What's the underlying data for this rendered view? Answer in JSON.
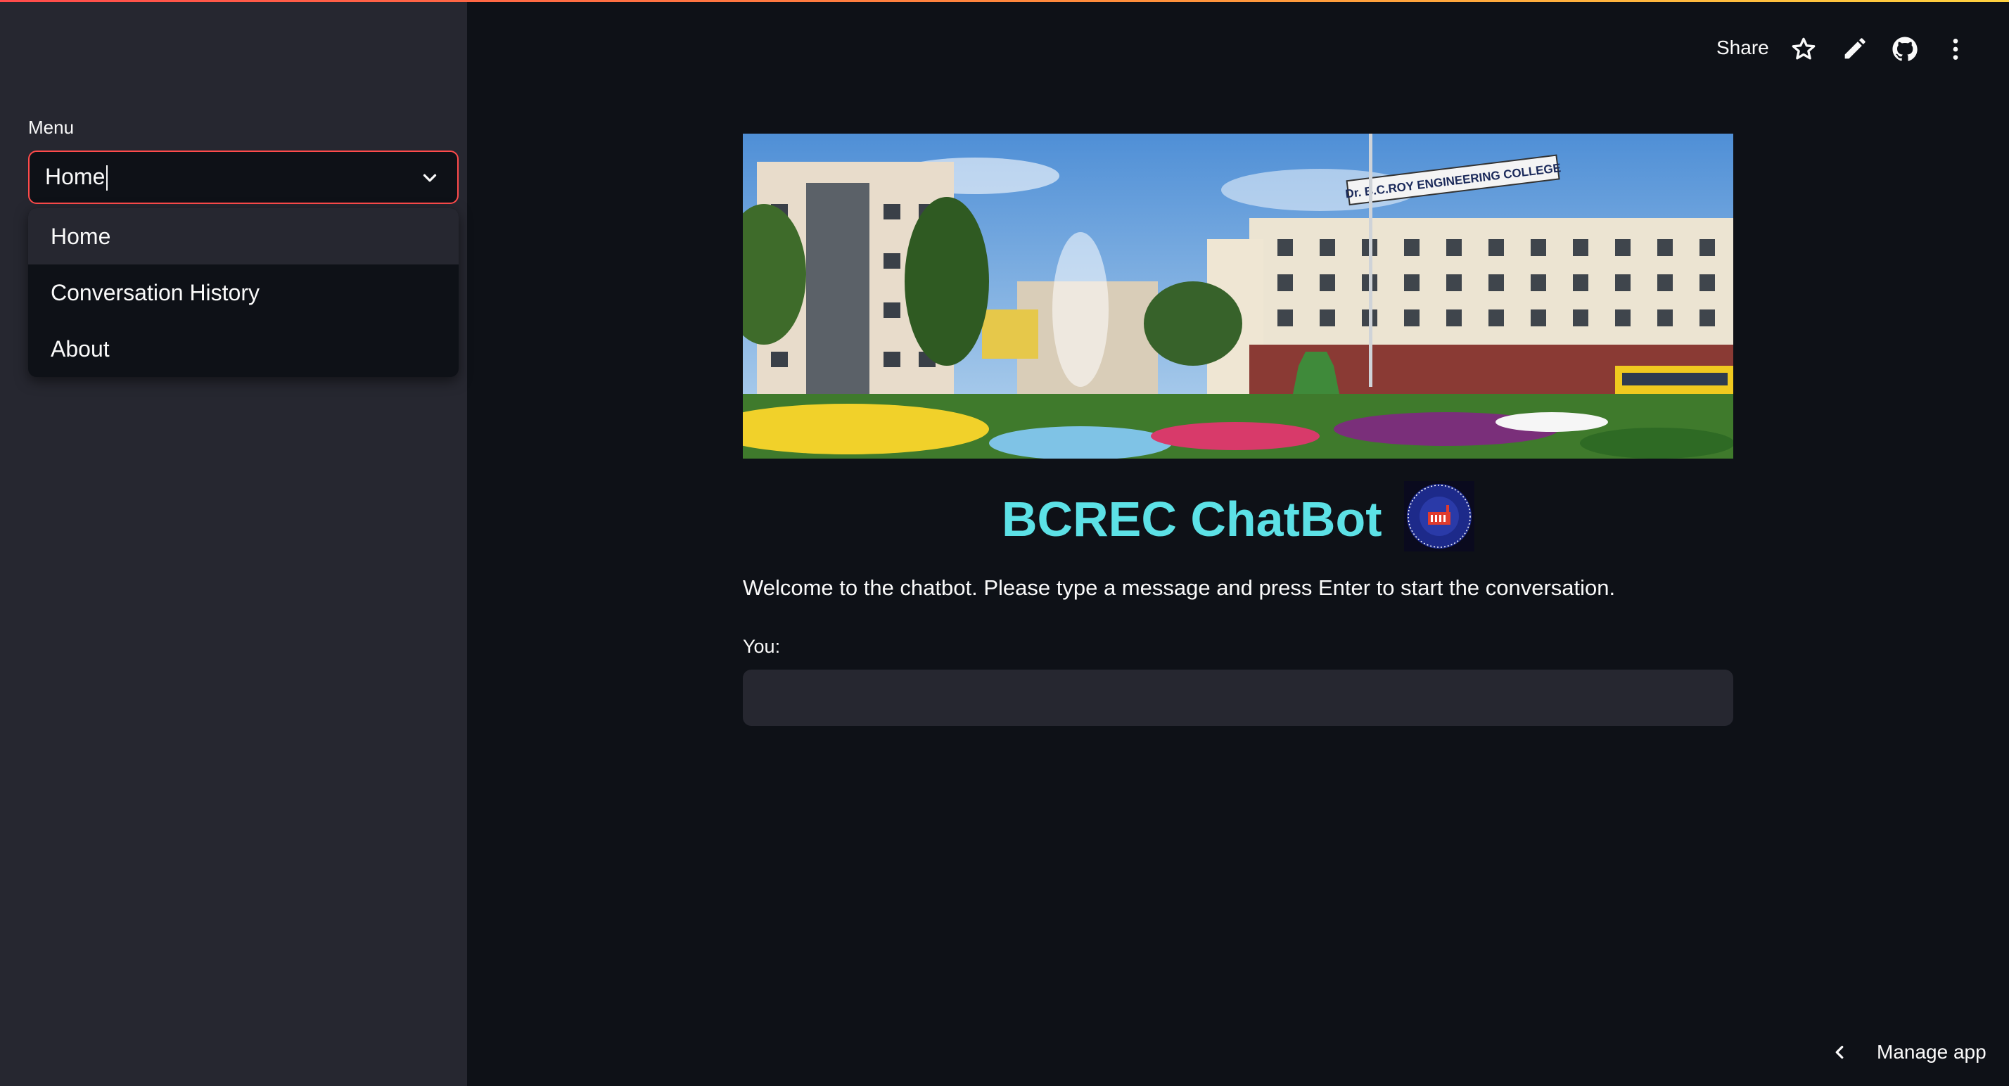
{
  "sidebar": {
    "label": "Menu",
    "select": {
      "value": "Home"
    },
    "options": [
      "Home",
      "Conversation History",
      "About"
    ]
  },
  "toolbar": {
    "share_label": "Share",
    "icons": [
      "star-icon",
      "pencil-icon",
      "github-icon",
      "more-vertical-icon"
    ]
  },
  "main": {
    "title": "BCREC ChatBot",
    "banner_sign_text": "Dr. B.C.ROY ENGINEERING COLLEGE",
    "welcome_text": "Welcome to the chatbot. Please type a message and press Enter to start the conversation.",
    "input_label": "You:",
    "input_value": ""
  },
  "footer": {
    "manage_label": "Manage app"
  },
  "colors": {
    "accent": "#ff4b4b",
    "title": "#5ce1e6",
    "background": "#0e1117",
    "sidebar": "#262730"
  }
}
